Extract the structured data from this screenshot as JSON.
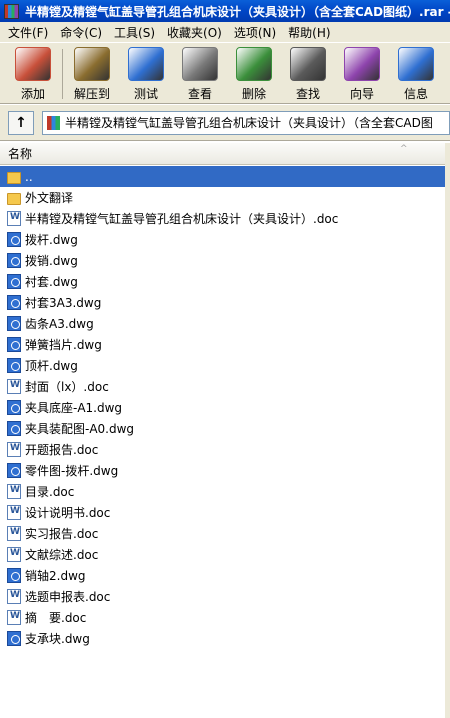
{
  "window": {
    "title": "半精镗及精镗气缸盖导管孔组合机床设计（夹具设计）（含全套CAD图纸）.rar - "
  },
  "menu": [
    "文件(F)",
    "命令(C)",
    "工具(S)",
    "收藏夹(O)",
    "选项(N)",
    "帮助(H)"
  ],
  "toolbar": [
    {
      "label": "添加",
      "icon": "add-archive-icon",
      "color": "#c8503a"
    },
    {
      "label": "解压到",
      "icon": "extract-to-icon",
      "color": "#8a6d2f"
    },
    {
      "label": "测试",
      "icon": "test-icon",
      "color": "#2f6fd1"
    },
    {
      "label": "查看",
      "icon": "view-icon",
      "color": "#7a7a7a"
    },
    {
      "label": "删除",
      "icon": "delete-icon",
      "color": "#3b8f3b"
    },
    {
      "label": "查找",
      "icon": "find-icon",
      "color": "#5a5a5a"
    },
    {
      "label": "向导",
      "icon": "wizard-icon",
      "color": "#8e44ad"
    },
    {
      "label": "信息",
      "icon": "info-icon",
      "color": "#2f6fd1"
    }
  ],
  "address": {
    "up_label": "↑",
    "path": "半精镗及精镗气缸盖导管孔组合机床设计（夹具设计）（含全套CAD图"
  },
  "list": {
    "header": "名称",
    "sort_arrow": "^",
    "rows": [
      {
        "name": "..",
        "icon": "folder-up",
        "selected": true
      },
      {
        "name": "外文翻译",
        "icon": "folder"
      },
      {
        "name": "半精镗及精镗气缸盖导管孔组合机床设计（夹具设计）.doc",
        "icon": "doc"
      },
      {
        "name": "拨杆.dwg",
        "icon": "dwg"
      },
      {
        "name": "拨销.dwg",
        "icon": "dwg"
      },
      {
        "name": "衬套.dwg",
        "icon": "dwg"
      },
      {
        "name": "衬套3A3.dwg",
        "icon": "dwg"
      },
      {
        "name": "齿条A3.dwg",
        "icon": "dwg"
      },
      {
        "name": "弹簧挡片.dwg",
        "icon": "dwg"
      },
      {
        "name": "顶杆.dwg",
        "icon": "dwg"
      },
      {
        "name": "封面（lx）.doc",
        "icon": "doc"
      },
      {
        "name": "夹具底座-A1.dwg",
        "icon": "dwg"
      },
      {
        "name": "夹具装配图-A0.dwg",
        "icon": "dwg"
      },
      {
        "name": "开题报告.doc",
        "icon": "doc"
      },
      {
        "name": "零件图-拨杆.dwg",
        "icon": "dwg"
      },
      {
        "name": "目录.doc",
        "icon": "doc"
      },
      {
        "name": "设计说明书.doc",
        "icon": "doc"
      },
      {
        "name": "实习报告.doc",
        "icon": "doc"
      },
      {
        "name": "文献综述.doc",
        "icon": "doc"
      },
      {
        "name": "销轴2.dwg",
        "icon": "dwg"
      },
      {
        "name": "选题申报表.doc",
        "icon": "doc"
      },
      {
        "name": "摘　要.doc",
        "icon": "doc"
      },
      {
        "name": "支承块.dwg",
        "icon": "dwg"
      }
    ]
  },
  "colors": {
    "titlebar": "#0046c6",
    "chrome": "#ece9d8",
    "selection": "#316ac5"
  }
}
